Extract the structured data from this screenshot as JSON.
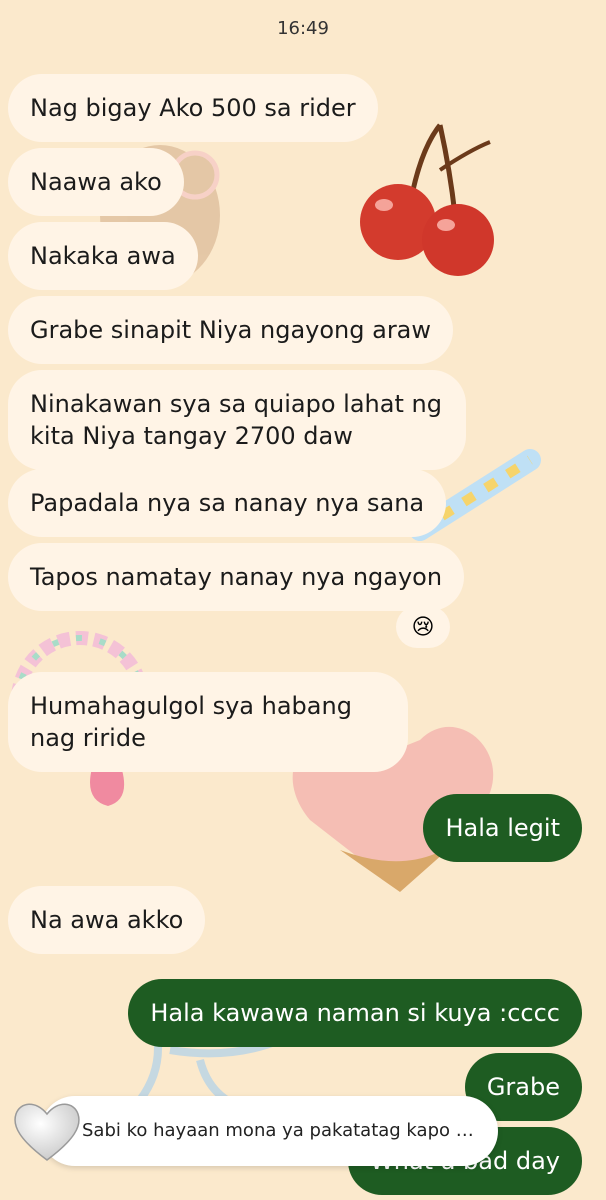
{
  "status_time": "16:49",
  "messages": [
    {
      "side": "in",
      "text": "Nag bigay Ako 500 sa rider"
    },
    {
      "side": "in",
      "text": "Naawa ako"
    },
    {
      "side": "in",
      "text": "Nakaka awa"
    },
    {
      "side": "in",
      "text": "Grabe sinapit Niya ngayong araw"
    },
    {
      "side": "in",
      "text": "Ninakawan sya sa quiapo lahat ng kita Niya tangay 2700 daw"
    },
    {
      "side": "in",
      "text": "Papadala nya sa nanay nya sana"
    },
    {
      "side": "in",
      "text": "Tapos namatay nanay nya ngayon"
    },
    {
      "side": "in",
      "text": "Humahagulgol sya habang nag riride"
    },
    {
      "side": "out",
      "text": "Hala legit"
    },
    {
      "side": "in",
      "text": "Na awa akko"
    },
    {
      "side": "out",
      "text": "Hala kawawa naman si kuya :cccc"
    },
    {
      "side": "out",
      "text": "Grabe"
    },
    {
      "side": "out",
      "text": "What a bad day"
    }
  ],
  "reaction": {
    "emoji": "😢",
    "icon": "crying-face-icon"
  },
  "reply_preview": {
    "text": "Sabi ko hayaan mona ya pakatatag kapo kai…",
    "icon": "white-heart-icon"
  },
  "colors": {
    "background": "#fbe9cc",
    "incoming": "#fff4e6",
    "outgoing": "#1e5c22"
  }
}
